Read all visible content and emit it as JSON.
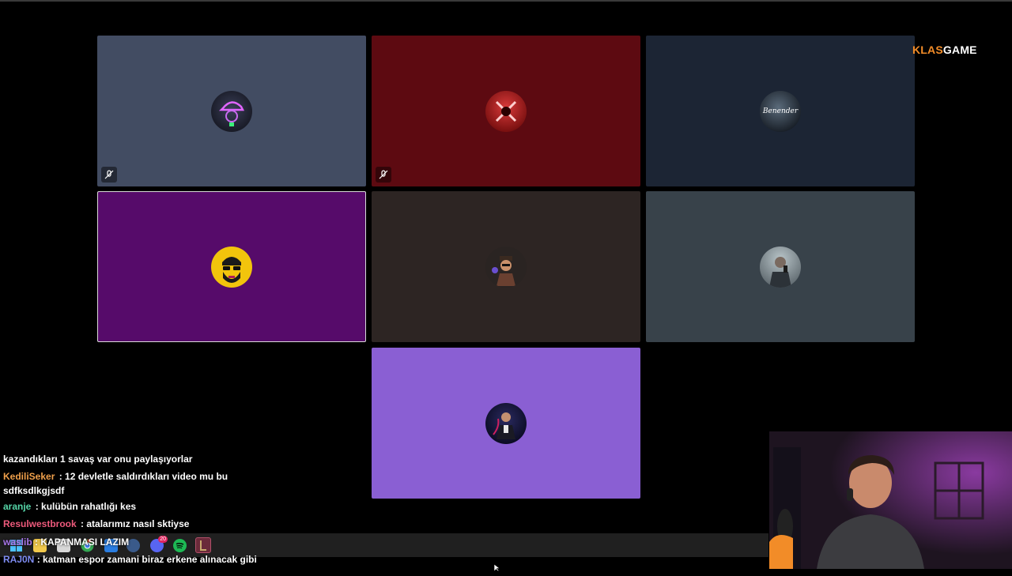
{
  "brand": {
    "prefix": "KLAS",
    "suffix": "GAME"
  },
  "colors": {
    "background": "#000000",
    "tile_slate": "#424c62",
    "tile_crimson": "#5d0a11",
    "tile_navy": "#1c2534",
    "tile_purple": "#560b6a",
    "tile_brown": "#2d2523",
    "tile_gray": "#38424a",
    "tile_lavender": "#8a5fd3",
    "brand_accent": "#f28c28"
  },
  "participants": [
    {
      "avatar": "neon-cap-avatar",
      "muted": true
    },
    {
      "avatar": "red-emblem-avatar",
      "muted": true
    },
    {
      "avatar": "benender-avatar",
      "avatar_text": "Benender",
      "muted": false
    },
    {
      "avatar": "bearded-sunglasses-avatar",
      "muted": false
    },
    {
      "avatar": "cartoon-character-avatar",
      "muted": false
    },
    {
      "avatar": "selfie-photo-avatar",
      "muted": false
    },
    {
      "avatar": "seated-man-avatar",
      "muted": false
    }
  ],
  "chat": [
    {
      "user": "",
      "user_color": "#ffffff",
      "message": "kazandıkları 1 savaş var onu paylaşıyorlar"
    },
    {
      "user": "KediliSeker",
      "user_color": "#f0a04b",
      "message": "12 devletle saldırdıkları video mu bu sdfksdlkgjsdf"
    },
    {
      "user": "aranje",
      "user_color": "#56d6a8",
      "message": "kulübün rahatlığı kes"
    },
    {
      "user": "Resulwestbrook",
      "user_color": "#ee5a7c",
      "message": "atalarımız nasıl sktiyse"
    },
    {
      "user": "waslib",
      "user_color": "#a876e8",
      "message": "KAPANMASI LAZIM"
    },
    {
      "user": "RAJ0N",
      "user_color": "#7e8cf2",
      "message": "katman espor zamani biraz erkene alınacak gibi"
    }
  ],
  "taskbar": {
    "icons": [
      "windows-icon",
      "file-explorer-icon",
      "notepad-icon",
      "chrome-icon",
      "mail-icon",
      "steam-icon",
      "discord-icon",
      "spotify-icon",
      "league-of-legends-icon"
    ],
    "discord_badge": "20"
  }
}
